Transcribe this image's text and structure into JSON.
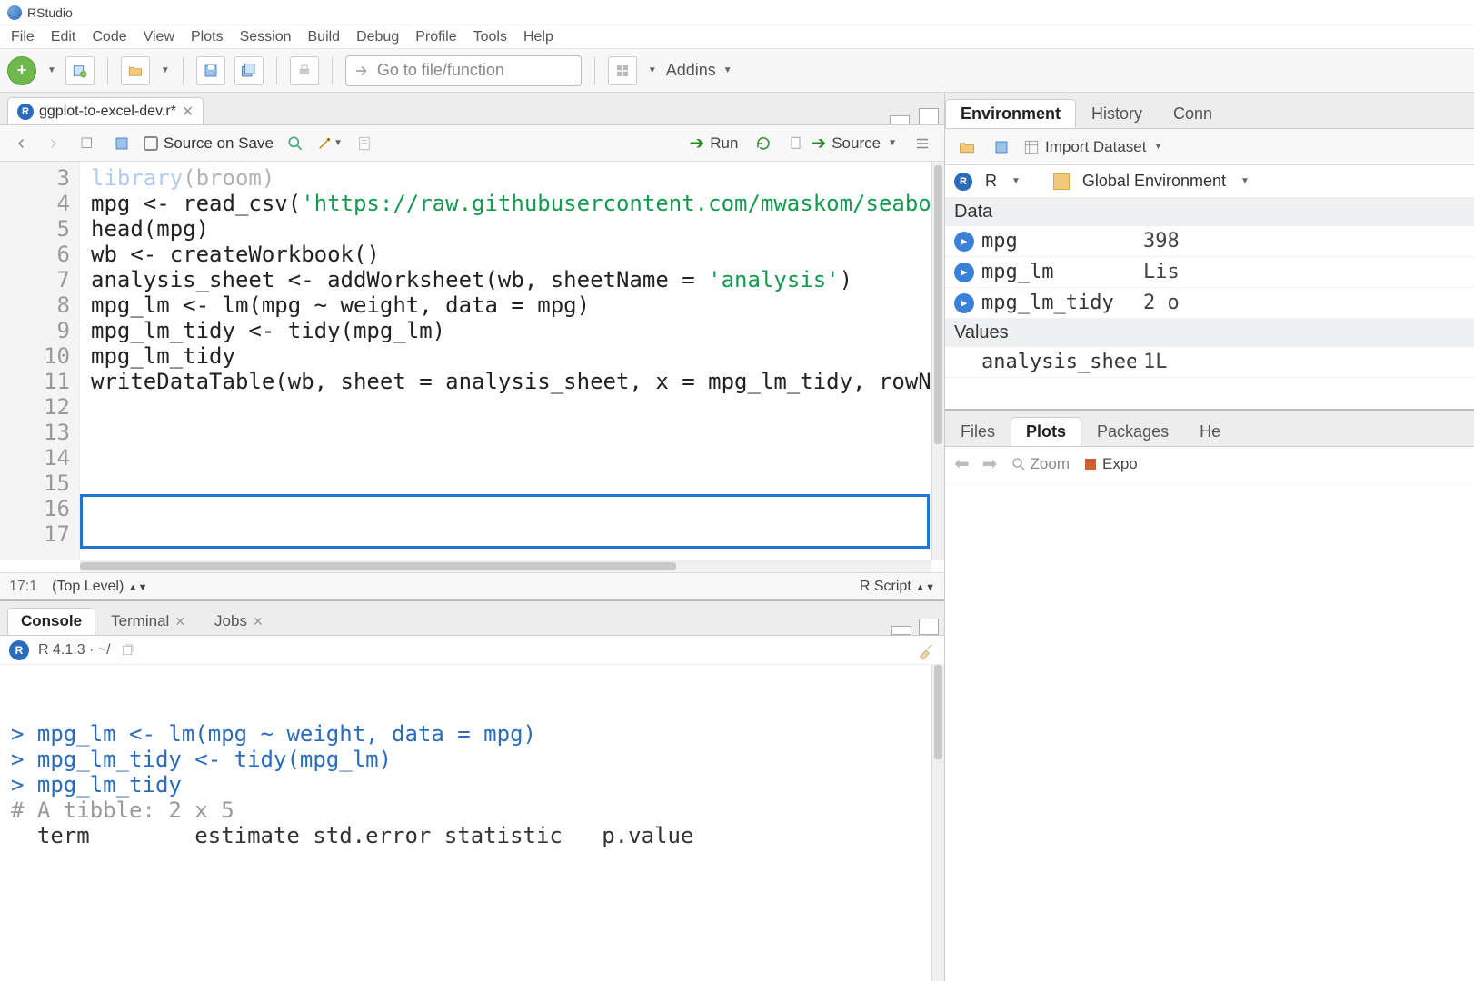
{
  "app": {
    "title": "RStudio"
  },
  "menubar": [
    "File",
    "Edit",
    "Code",
    "View",
    "Plots",
    "Session",
    "Build",
    "Debug",
    "Profile",
    "Tools",
    "Help"
  ],
  "toolbar": {
    "goto_placeholder": "Go to file/function",
    "addins_label": "Addins"
  },
  "source": {
    "tab_name": "ggplot-to-excel-dev.r*",
    "source_on_save": "Source on Save",
    "run_label": "Run",
    "source_label": "Source",
    "lines": [
      {
        "n": 3,
        "text": "library(broom)",
        "cls": "kw partial"
      },
      {
        "n": 4,
        "text": ""
      },
      {
        "n": 5,
        "text": "mpg <- read_csv('https://raw.githubusercontent.com/mwaskom/seabo"
      },
      {
        "n": 6,
        "text": "head(mpg)"
      },
      {
        "n": 7,
        "text": ""
      },
      {
        "n": 8,
        "text": "wb <- createWorkbook()"
      },
      {
        "n": 9,
        "text": "analysis_sheet <- addWorksheet(wb, sheetName = 'analysis')"
      },
      {
        "n": 10,
        "text": ""
      },
      {
        "n": 11,
        "text": "mpg_lm <- lm(mpg ~ weight, data = mpg)"
      },
      {
        "n": 12,
        "text": "mpg_lm_tidy <- tidy(mpg_lm)"
      },
      {
        "n": 13,
        "text": ""
      },
      {
        "n": 14,
        "text": "mpg_lm_tidy"
      },
      {
        "n": 15,
        "text": ""
      },
      {
        "n": 16,
        "text": "writeDataTable(wb, sheet = analysis_sheet, x = mpg_lm_tidy, rowN"
      },
      {
        "n": 17,
        "text": ""
      }
    ],
    "highlight_lines": [
      16,
      17
    ],
    "cursor_pos": "17:1",
    "scope": "(Top Level)",
    "mode": "R Script"
  },
  "console": {
    "tabs": [
      "Console",
      "Terminal",
      "Jobs"
    ],
    "active_tab": 0,
    "info": "R 4.1.3 · ~/",
    "output": [
      {
        "type": "cmd",
        "text": "mpg_lm <- lm(mpg ~ weight, data = mpg)"
      },
      {
        "type": "cmd",
        "text": "mpg_lm_tidy <- tidy(mpg_lm)"
      },
      {
        "type": "cmd",
        "text": "mpg_lm_tidy"
      },
      {
        "type": "comment",
        "text": "# A tibble: 2 x 5"
      },
      {
        "type": "header",
        "text": "  term        estimate std.error statistic   p.value"
      }
    ]
  },
  "environment": {
    "tabs": [
      "Environment",
      "History",
      "Conn"
    ],
    "active_tab": 0,
    "import_label": "Import Dataset",
    "scope_lang": "R",
    "scope_label": "Global Environment",
    "sections": [
      {
        "title": "Data",
        "rows": [
          {
            "name": "mpg",
            "value": "398",
            "play": true
          },
          {
            "name": "mpg_lm",
            "value": "Lis",
            "play": true
          },
          {
            "name": "mpg_lm_tidy",
            "value": "2 o",
            "play": true
          }
        ]
      },
      {
        "title": "Values",
        "rows": [
          {
            "name": "analysis_sheet",
            "value": "1L",
            "play": false
          }
        ]
      }
    ]
  },
  "plots": {
    "tabs": [
      "Files",
      "Plots",
      "Packages",
      "He"
    ],
    "active_tab": 1,
    "zoom_label": "Zoom",
    "export_label": "Expo"
  }
}
